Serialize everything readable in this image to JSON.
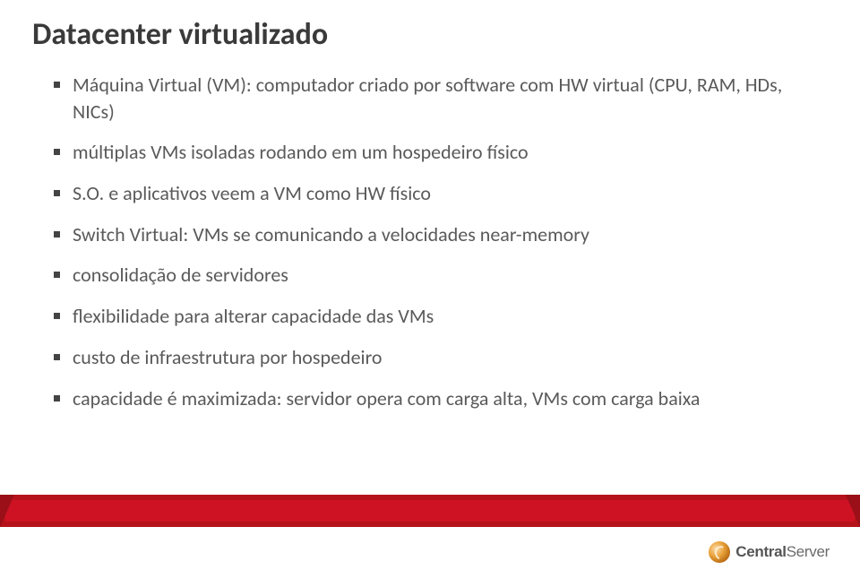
{
  "title": "Datacenter virtualizado",
  "bullets": [
    "Máquina Virtual (VM): computador criado por software com HW virtual (CPU, RAM, HDs, NICs)",
    "múltiplas VMs isoladas rodando em um hospedeiro físico",
    "S.O. e aplicativos veem a VM como HW físico",
    "Switch Virtual: VMs se comunicando a velocidades near-memory",
    "consolidação de servidores",
    "flexibilidade para alterar capacidade das VMs",
    "custo de infraestrutura por hospedeiro",
    "capacidade é maximizada: servidor opera com carga alta, VMs com carga baixa"
  ],
  "logo": {
    "bold": "Central",
    "light": "Server"
  }
}
